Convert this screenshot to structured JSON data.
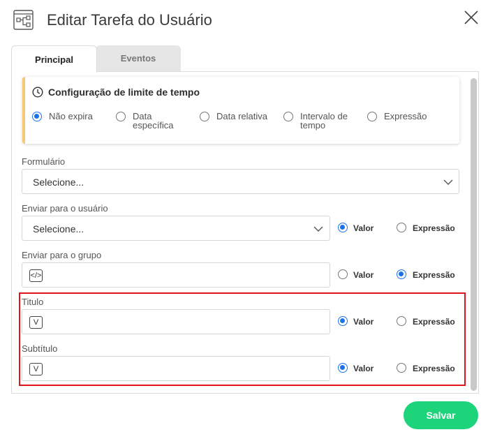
{
  "header": {
    "title": "Editar Tarefa do Usuário",
    "icon": "workflow-icon",
    "close_icon": "close-icon"
  },
  "tabs": [
    {
      "label": "Principal",
      "active": true
    },
    {
      "label": "Eventos",
      "active": false
    }
  ],
  "time_limit": {
    "title": "Configuração de limite de tempo",
    "options": [
      {
        "line1": "Não expira",
        "line2": "",
        "selected": true
      },
      {
        "line1": "Data",
        "line2": "específica",
        "selected": false
      },
      {
        "line1": "Data relativa",
        "line2": "",
        "selected": false
      },
      {
        "line1": "Intervalo de",
        "line2": "tempo",
        "selected": false
      },
      {
        "line1": "Expressão",
        "line2": "",
        "selected": false
      }
    ]
  },
  "form": {
    "formulario": {
      "label": "Formulário",
      "value": "Selecione..."
    },
    "usuario": {
      "label": "Enviar para o usuário",
      "value": "Selecione...",
      "mode": "Valor"
    },
    "grupo": {
      "label": "Enviar para o grupo",
      "icon_text": "</>",
      "mode": "Expressão"
    },
    "titulo": {
      "label": "Titulo",
      "icon_text": "V",
      "mode": "Valor"
    },
    "subtitulo": {
      "label": "Subtítulo",
      "icon_text": "V",
      "mode": "Valor"
    },
    "mode_labels": {
      "valor": "Valor",
      "expressao": "Expressão"
    }
  },
  "footer": {
    "save_label": "Salvar"
  },
  "colors": {
    "accent": "#1a73e8",
    "save": "#1dd47a",
    "highlight": "#e0151b",
    "card_accent": "#f7c873"
  }
}
